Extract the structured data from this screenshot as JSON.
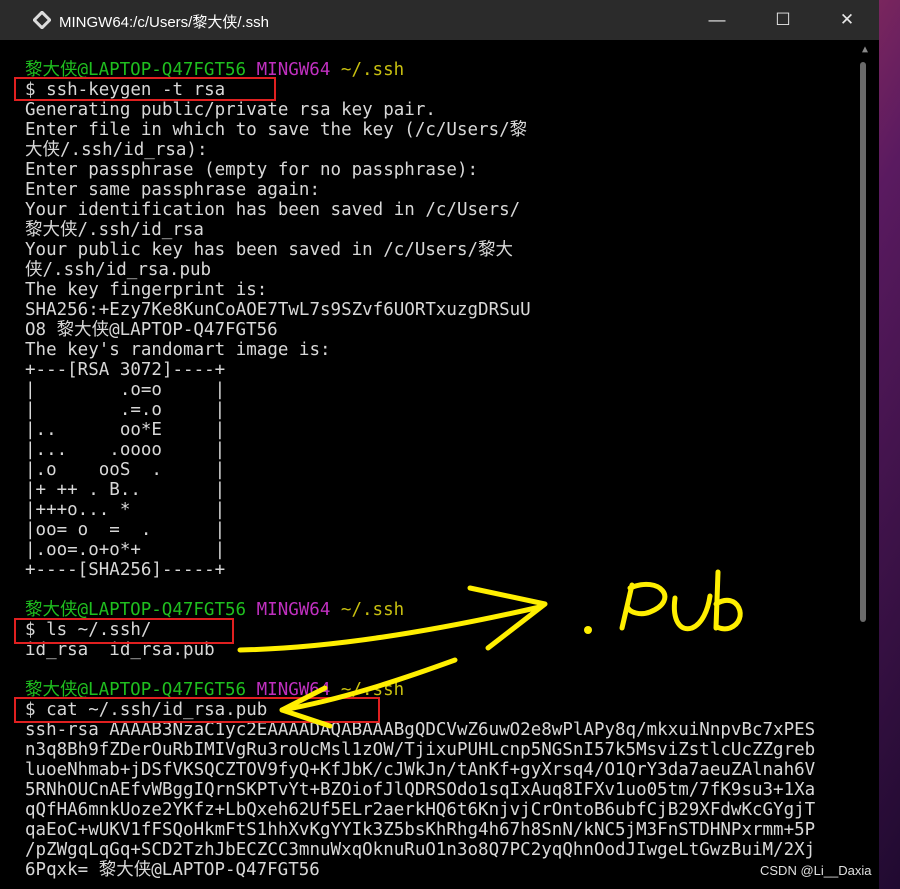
{
  "window": {
    "title": "MINGW64:/c/Users/黎大侠/.ssh",
    "buttons": {
      "minimize": "—",
      "maximize": "☐",
      "close": "✕"
    }
  },
  "terminal": {
    "lines": [
      [
        {
          "t": "黎大侠@LAPTOP-Q47FGT56 ",
          "c": "green"
        },
        {
          "t": "MINGW64 ",
          "c": "magenta"
        },
        {
          "t": "~/.ssh",
          "c": "yellow"
        }
      ],
      [
        {
          "t": "$ ssh-keygen -t rsa"
        }
      ],
      [
        {
          "t": "Generating public/private rsa key pair."
        }
      ],
      [
        {
          "t": "Enter file in which to save the key (/c/Users/黎"
        }
      ],
      [
        {
          "t": "大侠/.ssh/id_rsa):"
        }
      ],
      [
        {
          "t": "Enter passphrase (empty for no passphrase):"
        }
      ],
      [
        {
          "t": "Enter same passphrase again:"
        }
      ],
      [
        {
          "t": "Your identification has been saved in /c/Users/"
        }
      ],
      [
        {
          "t": "黎大侠/.ssh/id_rsa"
        }
      ],
      [
        {
          "t": "Your public key has been saved in /c/Users/黎大"
        }
      ],
      [
        {
          "t": "侠/.ssh/id_rsa.pub"
        }
      ],
      [
        {
          "t": "The key fingerprint is:"
        }
      ],
      [
        {
          "t": "SHA256:+Ezy7Ke8KunCoAOE7TwL7s9SZvf6UORTxuzgDRSuU"
        }
      ],
      [
        {
          "t": "O8 黎大侠@LAPTOP-Q47FGT56"
        }
      ],
      [
        {
          "t": "The key's randomart image is:"
        }
      ],
      [
        {
          "t": "+---[RSA 3072]----+"
        }
      ],
      [
        {
          "t": "|        .o=o     |"
        }
      ],
      [
        {
          "t": "|        .=.o     |"
        }
      ],
      [
        {
          "t": "|..      oo*E     |"
        }
      ],
      [
        {
          "t": "|...    .oooo     |"
        }
      ],
      [
        {
          "t": "|.o    ooS  .     |"
        }
      ],
      [
        {
          "t": "|+ ++ . B..       |"
        }
      ],
      [
        {
          "t": "|+++o... *        |"
        }
      ],
      [
        {
          "t": "|oo= o  =  .      |"
        }
      ],
      [
        {
          "t": "|.oo=.o+o*+       |"
        }
      ],
      [
        {
          "t": "+----[SHA256]-----+"
        }
      ],
      [
        {
          "t": ""
        }
      ],
      [
        {
          "t": "黎大侠@LAPTOP-Q47FGT56 ",
          "c": "green"
        },
        {
          "t": "MINGW64 ",
          "c": "magenta"
        },
        {
          "t": "~/.ssh",
          "c": "yellow"
        }
      ],
      [
        {
          "t": "$ ls ~/.ssh/"
        }
      ],
      [
        {
          "t": "id_rsa  id_rsa.pub"
        }
      ],
      [
        {
          "t": ""
        }
      ],
      [
        {
          "t": "黎大侠@LAPTOP-Q47FGT56 ",
          "c": "green"
        },
        {
          "t": "MINGW64 ",
          "c": "magenta"
        },
        {
          "t": "~/.ssh",
          "c": "yellow"
        }
      ],
      [
        {
          "t": "$ cat ~/.ssh/id_rsa.pub"
        }
      ],
      [
        {
          "t": "ssh-rsa AAAAB3NzaC1yc2EAAAADAQABAAABgQDCVwZ6uwO2e8wPlAPy8q/mkxuiNnpvBc7xPES"
        }
      ],
      [
        {
          "t": "n3q8Bh9fZDerOuRbIMIVgRu3roUcMsl1zOW/TjixuPUHLcnp5NGSnI57k5MsviZstlcUcZZgreb"
        }
      ],
      [
        {
          "t": "luoeNhmab+jDSfVKSQCZTOV9fyQ+KfJbK/cJWkJn/tAnKf+gyXrsq4/O1QrY3da7aeuZAlnah6V"
        }
      ],
      [
        {
          "t": "5RNhOUCnAEfvWBggIQrnSKPTvYt+BZOiofJlQDRSOdo1sqIxAuq8IFXv1uo05tm/7fK9su3+1Xa"
        }
      ],
      [
        {
          "t": "qQfHA6mnkUoze2YKfz+LbQxeh62Uf5ELr2aerkHQ6t6KnjvjCrOntoB6ubfCjB29XFdwKcGYgjT"
        }
      ],
      [
        {
          "t": "qaEoC+wUKV1fFSQoHkmFtS1hhXvKgYYIk3Z5bsKhRhg4h67h8SnN/kNC5jM3FnSTDHNPxrmm+5P"
        }
      ],
      [
        {
          "t": "/pZWgqLqGq+SCD2TzhJbECZCC3mnuWxqOknuRuO1n3o8Q7PC2yqQhnOodJIwgeLtGwzBuiM/2Xj"
        }
      ],
      [
        {
          "t": "6Pqxk= 黎大侠@LAPTOP-Q47FGT56"
        }
      ]
    ]
  },
  "annotation": {
    "handwritten": ".Pub",
    "highlight_color": "#e02020",
    "pen_color": "#ffef00"
  },
  "watermark": "CSDN @Li__Daxia"
}
